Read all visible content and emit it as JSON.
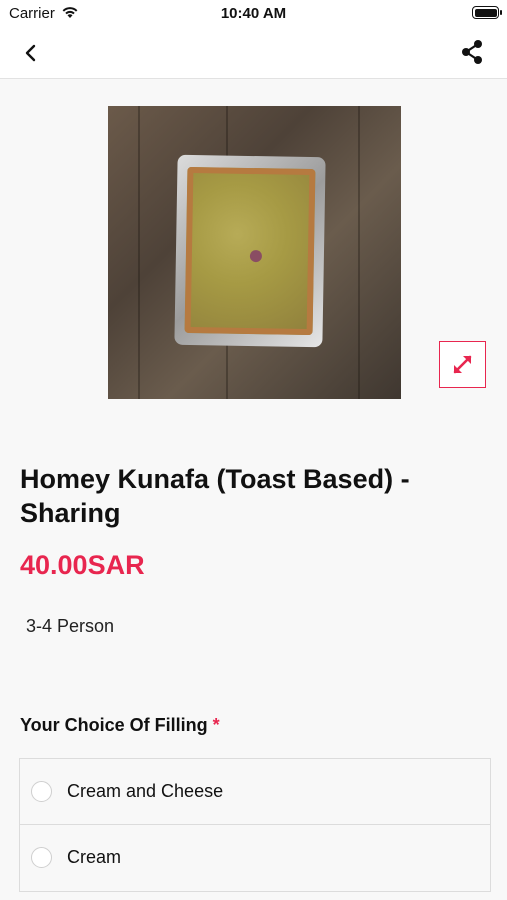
{
  "status_bar": {
    "carrier": "Carrier",
    "time": "10:40 AM",
    "icons": [
      "wifi-icon",
      "battery-icon"
    ]
  },
  "nav": {
    "back_icon": "chevron-left-icon",
    "share_icon": "share-icon"
  },
  "product": {
    "image_alt": "kunafa-tray-photo",
    "expand_icon": "expand-arrows-icon",
    "title": "Homey Kunafa (Toast Based) - Sharing",
    "price": "40.00SAR",
    "description": "3-4 Person"
  },
  "filling_section": {
    "title": "Your Choice Of Filling",
    "required_mark": "*",
    "options": [
      {
        "label": "Cream and Cheese",
        "selected": false
      },
      {
        "label": "Cream",
        "selected": false
      }
    ]
  },
  "colors": {
    "accent": "#e8264f",
    "background": "#f8f8f8",
    "text": "#111111"
  }
}
